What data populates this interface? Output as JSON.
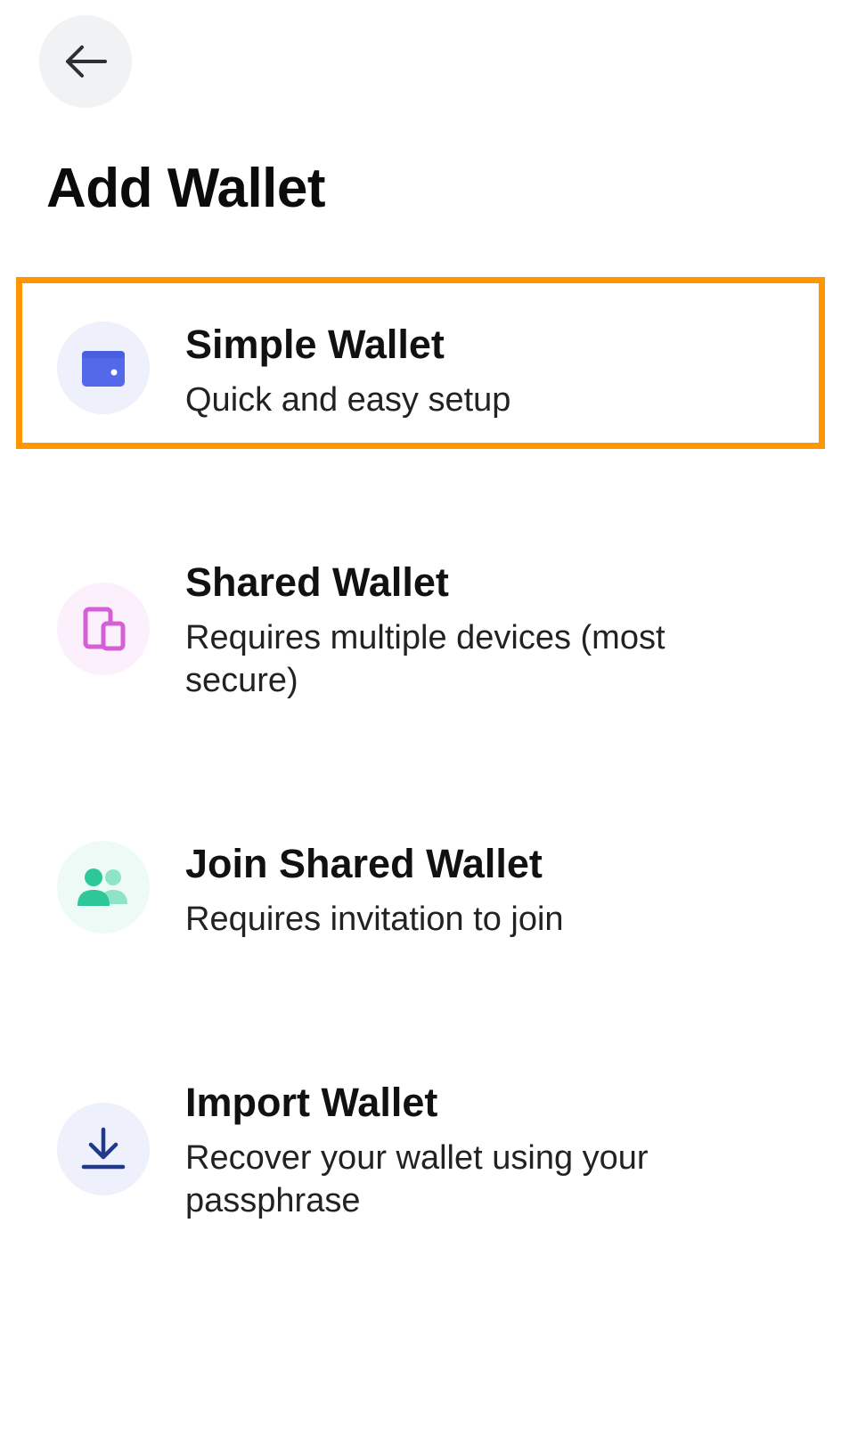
{
  "header": {
    "back_icon": "arrow-left-icon",
    "title": "Add Wallet"
  },
  "options": [
    {
      "title": "Simple Wallet",
      "subtitle": "Quick and easy setup",
      "icon": "wallet-icon",
      "icon_color": "#5468ea",
      "icon_bg": "#eef0fb",
      "highlighted": true
    },
    {
      "title": "Shared Wallet",
      "subtitle": "Requires multiple devices (most secure)",
      "icon": "devices-icon",
      "icon_color": "#d45fd6",
      "icon_bg": "#fbf0fc"
    },
    {
      "title": "Join Shared Wallet",
      "subtitle": "Requires invitation to join",
      "icon": "users-icon",
      "icon_color": "#2ec79a",
      "icon_bg": "#eefaf6"
    },
    {
      "title": "Import Wallet",
      "subtitle": "Recover your wallet using your passphrase",
      "icon": "download-icon",
      "icon_color": "#1f3a8a",
      "icon_bg": "#eef0fb"
    }
  ],
  "colors": {
    "highlight": "#ff9500",
    "back_button_bg": "#f1f2f4"
  }
}
